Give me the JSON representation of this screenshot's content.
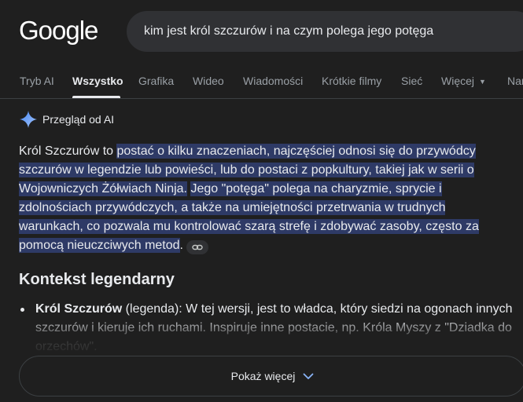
{
  "header": {
    "logo": "Google",
    "search_value": "kim jest król szczurów i na czym polega jego potęga"
  },
  "tabs": [
    {
      "label": "Tryb AI"
    },
    {
      "label": "Wszystko",
      "active": true
    },
    {
      "label": "Grafika"
    },
    {
      "label": "Wideo"
    },
    {
      "label": "Wiadomości"
    },
    {
      "label": "Krótkie filmy"
    },
    {
      "label": "Sieć"
    },
    {
      "label": "Więcej"
    },
    {
      "label": "Nar"
    }
  ],
  "ai_overview": {
    "title": "Przegląd od AI",
    "intro": "Król Szczurów to ",
    "highlight_1": "postać o kilku znaczeniach, najczęściej odnosi się do przywódcy szczurów w legendzie lub powieści, lub do postaci z popkultury, takiej jak w serii o Wojowniczych Żółwiach Ninja.",
    "highlight_2": "Jego \"potęga\" polega na charyzmie, sprycie i zdolnościach przywódczych, a także na umiejętności przetrwania w trudnych warunkach, co pozwala mu kontrolować szarą strefę i zdobywać zasoby, często za pomocą nieuczciwych metod",
    "end": "."
  },
  "section": {
    "heading": "Kontekst legendarny",
    "bullets": [
      {
        "bold": "Król Szczurów",
        "rest": " (legenda): W tej wersji, jest to władca, który siedzi na ogonach innych szczurów i kieruje ich ruchami. Inspiruje inne postacie, np. Króla Myszy z \"Dziadka do orzechów\"."
      }
    ]
  },
  "show_more": {
    "label": "Pokaż więcej"
  },
  "colors": {
    "background": "#1f1f1f",
    "search_bg": "#303134",
    "highlight": "#2e3a66",
    "text": "#e8eaed",
    "muted": "#9aa0a6",
    "sparkle": "#8ab4f8"
  }
}
